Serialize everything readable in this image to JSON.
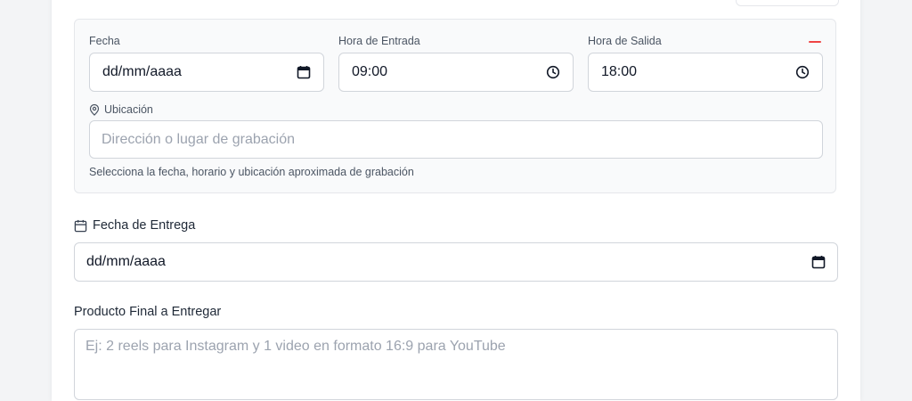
{
  "session": {
    "date_label": "Fecha",
    "date_value": "dd/mm/aaaa",
    "start_label": "Hora de Entrada",
    "start_value": "09:00",
    "end_label": "Hora de Salida",
    "end_value": "18:00",
    "location_label": "Ubicación",
    "location_placeholder": "Dirección o lugar de grabación",
    "help_text": "Selecciona la fecha, horario y ubicación aproximada de grabación",
    "remove_color": "#ef4444"
  },
  "delivery": {
    "label": "Fecha de Entrega",
    "value": "dd/mm/aaaa"
  },
  "product": {
    "label": "Producto Final a Entregar",
    "placeholder": "Ej: 2 reels para Instagram y 1 video en formato 16:9 para YouTube"
  },
  "icons": {
    "calendar": "calendar-icon",
    "clock": "clock-icon",
    "location": "map-pin-icon",
    "remove": "minus-icon"
  }
}
